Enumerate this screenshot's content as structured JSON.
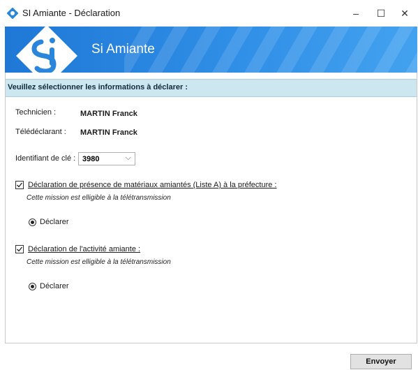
{
  "window": {
    "title": "SI Amiante - Déclaration",
    "minimize_glyph": "–",
    "maximize_glyph": "☐",
    "close_glyph": "✕",
    "icon": "app-icon"
  },
  "banner": {
    "brand": "Si Amiante",
    "logo_letters": "Si",
    "colors": {
      "start": "#1f78d6",
      "end": "#43a2ef"
    }
  },
  "section": {
    "header": "Veuillez sélectionner les informations à déclarer :"
  },
  "form": {
    "technician_label": "Technicien :",
    "technician_value": "MARTIN Franck",
    "teledeclarant_label": "Télédéclarant :",
    "teledeclarant_value": "MARTIN Franck",
    "key_label": "Identifiant de clé :",
    "key_value": "3980"
  },
  "declarations": [
    {
      "checked": true,
      "title": "Déclaration de présence de matériaux amiantés (Liste A) à la préfecture :",
      "note": "Cette mission est elligible à la télétransmission",
      "radio_label": "Déclarer"
    },
    {
      "checked": true,
      "title": "Déclaration de l'activité amiante :",
      "note": "Cette mission est elligible à la télétransmission",
      "radio_label": "Déclarer"
    }
  ],
  "footer": {
    "send_label": "Envoyer"
  }
}
